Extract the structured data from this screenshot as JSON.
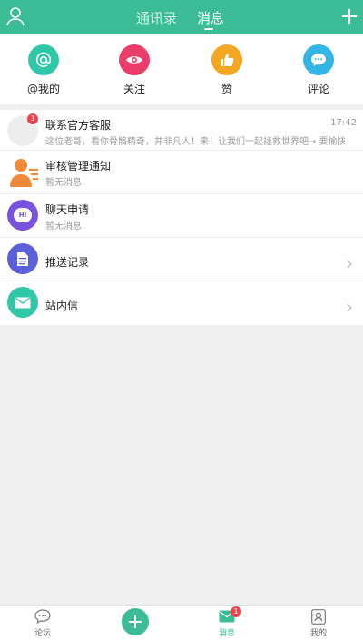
{
  "header": {
    "tab_contacts": "通讯录",
    "tab_messages": "消息"
  },
  "quick_actions": [
    {
      "label": "@我的",
      "icon": "at-icon",
      "color": "#2fc7a7"
    },
    {
      "label": "关注",
      "icon": "eye-icon",
      "color": "#ec3d6a"
    },
    {
      "label": "赞",
      "icon": "thumbs-up-icon",
      "color": "#f5a623"
    },
    {
      "label": "评论",
      "icon": "comment-icon",
      "color": "#33b5e5"
    }
  ],
  "messages": [
    {
      "title": "联系官方客服",
      "preview": "这位老哥，看你骨骼精奇，并非凡人！来！让我们一起拯救世界吧➝ 要愉快的玩...",
      "time": "17:42",
      "badge": "1"
    },
    {
      "title": "审核管理通知",
      "preview": "暂无消息"
    },
    {
      "title": "聊天申请",
      "preview": "暂无消息",
      "avatar_text": "HI"
    },
    {
      "title": "推送记录"
    },
    {
      "title": "站内信"
    }
  ],
  "bottom_nav": {
    "forum": "论坛",
    "messages": "消息",
    "messages_badge": "1",
    "mine": "我的"
  },
  "colors": {
    "brand": "#3cbc96"
  }
}
